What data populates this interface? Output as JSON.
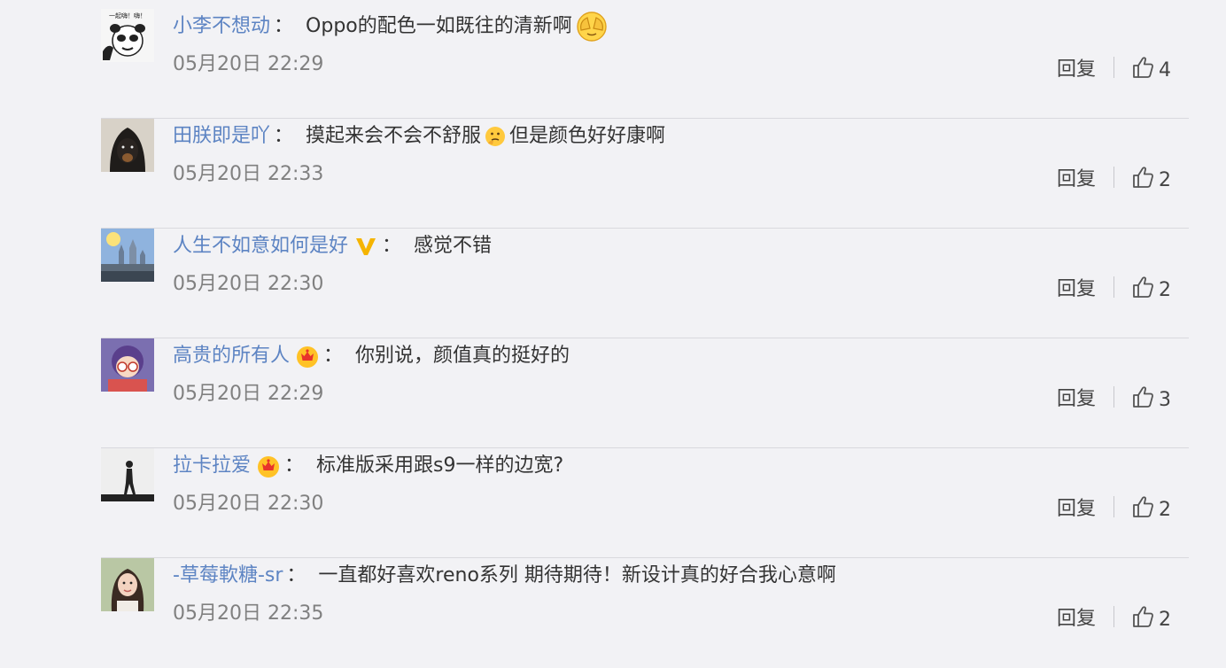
{
  "reply_label": "回复",
  "colors": {
    "username": "#5d84c3",
    "time": "#808080",
    "text": "#333333"
  },
  "comments": [
    {
      "user": "小李不想动",
      "colon": "：",
      "text_before": "Oppo的配色一如既往的清新啊",
      "text_after": "",
      "emoji": "crying-pray-emoji",
      "badge": "",
      "time": "05月20日 22:29",
      "likes": "4",
      "avatar": "panda-meme-avatar"
    },
    {
      "user": "田朕即是吖",
      "colon": "：",
      "text_before": "摸起来会不会不舒服",
      "text_after": "但是颜色好好康啊",
      "emoji": "thinking-emoji",
      "badge": "",
      "time": "05月20日 22:33",
      "likes": "2",
      "avatar": "dog-avatar"
    },
    {
      "user": "人生不如意如何是好",
      "colon": "：",
      "text_before": "感觉不错",
      "text_after": "",
      "emoji": "",
      "badge": "verified-v-badge",
      "time": "05月20日 22:30",
      "likes": "2",
      "avatar": "castle-avatar"
    },
    {
      "user": "高贵的所有人",
      "colon": "：",
      "text_before": "你别说，颜值真的挺好的",
      "text_after": "",
      "emoji": "",
      "badge": "crown-badge",
      "time": "05月20日 22:29",
      "likes": "3",
      "avatar": "anime-girl-avatar"
    },
    {
      "user": "拉卡拉爱",
      "colon": "：",
      "text_before": "标准版采用跟s9一样的边宽?",
      "text_after": "",
      "emoji": "",
      "badge": "crown-badge",
      "time": "05月20日 22:30",
      "likes": "2",
      "avatar": "silhouette-avatar"
    },
    {
      "user": "-草莓軟糖-sr",
      "colon": "：",
      "text_before": "一直都好喜欢reno系列 期待期待！新设计真的好合我心意啊",
      "text_after": "",
      "emoji": "",
      "badge": "",
      "time": "05月20日 22:35",
      "likes": "2",
      "avatar": "girl-photo-avatar"
    }
  ]
}
